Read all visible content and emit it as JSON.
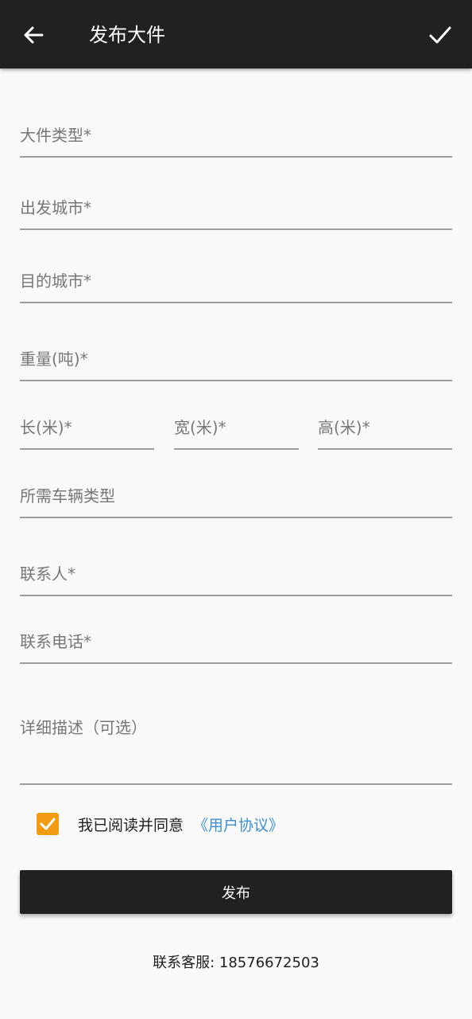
{
  "header": {
    "title": "发布大件",
    "back_icon": "arrow-left-icon",
    "confirm_icon": "check-icon"
  },
  "form": {
    "cargo_type": {
      "placeholder": "大件类型*",
      "value": ""
    },
    "departure_city": {
      "placeholder": "出发城市*",
      "value": ""
    },
    "destination_city": {
      "placeholder": "目的城市*",
      "value": ""
    },
    "weight": {
      "placeholder": "重量(吨)*",
      "value": ""
    },
    "length": {
      "placeholder": "长(米)*",
      "value": ""
    },
    "width": {
      "placeholder": "宽(米)*",
      "value": ""
    },
    "height": {
      "placeholder": "高(米)*",
      "value": ""
    },
    "vehicle_type": {
      "placeholder": "所需车辆类型",
      "value": ""
    },
    "contact_person": {
      "placeholder": "联系人*",
      "value": ""
    },
    "contact_phone": {
      "placeholder": "联系电话*",
      "value": ""
    },
    "description": {
      "placeholder": "详细描述（可选）",
      "value": ""
    }
  },
  "agreement": {
    "checked": true,
    "text": "我已阅读并同意",
    "link": "《用户协议》",
    "accent_color": "#f39c12",
    "link_color": "#3d8fd6"
  },
  "submit": {
    "label": "发布"
  },
  "footer": {
    "text": "联系客服: 18576672503"
  },
  "colors": {
    "app_bar": "#212121",
    "background": "#f9f9f9",
    "underline": "#9e9e9e"
  }
}
